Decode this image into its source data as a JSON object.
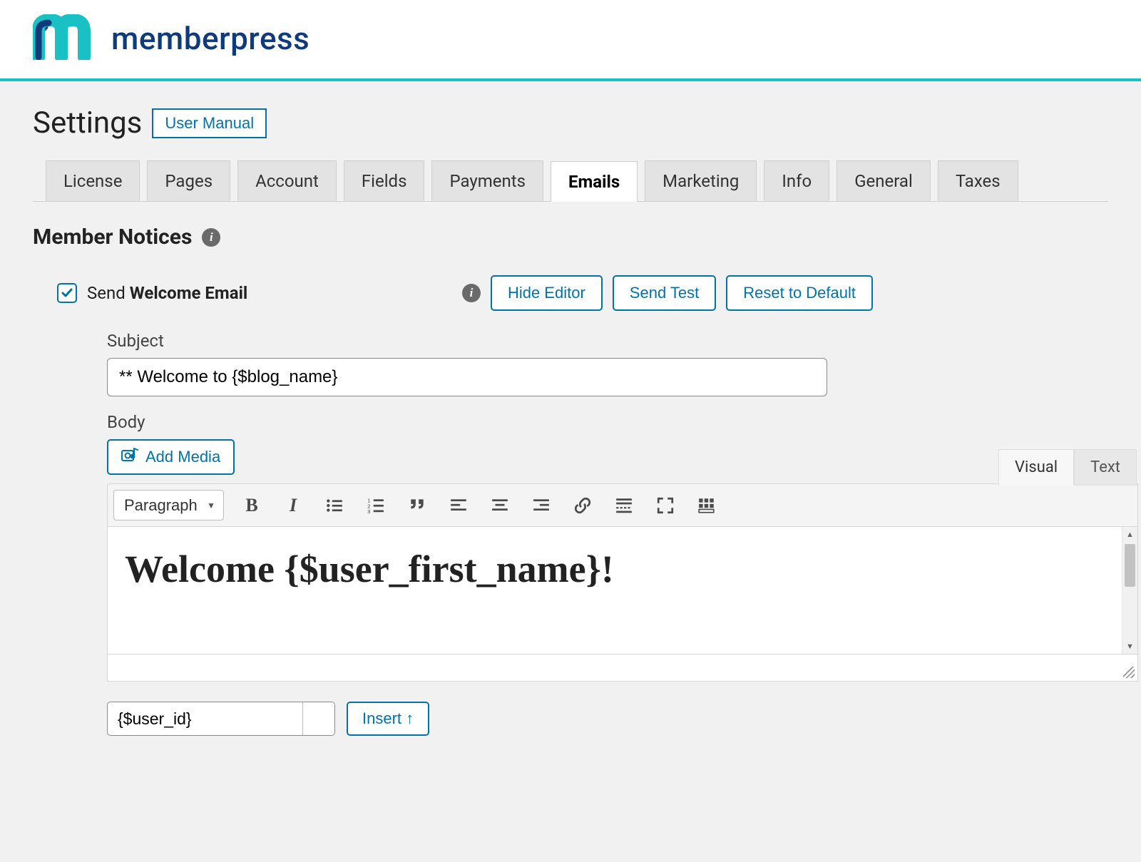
{
  "brand": {
    "name": "memberpress"
  },
  "header": {
    "title": "Settings",
    "manual_button": "User Manual"
  },
  "tabs": [
    {
      "label": "License",
      "active": false
    },
    {
      "label": "Pages",
      "active": false
    },
    {
      "label": "Account",
      "active": false
    },
    {
      "label": "Fields",
      "active": false
    },
    {
      "label": "Payments",
      "active": false
    },
    {
      "label": "Emails",
      "active": true
    },
    {
      "label": "Marketing",
      "active": false
    },
    {
      "label": "Info",
      "active": false
    },
    {
      "label": "General",
      "active": false
    },
    {
      "label": "Taxes",
      "active": false
    }
  ],
  "section": {
    "title": "Member Notices"
  },
  "notice": {
    "send_prefix": "Send ",
    "send_name": "Welcome Email",
    "checked": true,
    "actions": {
      "hide": "Hide Editor",
      "test": "Send Test",
      "reset": "Reset to Default"
    }
  },
  "subject": {
    "label": "Subject",
    "value": "** Welcome to {$blog_name}"
  },
  "body": {
    "label": "Body",
    "add_media": "Add Media",
    "editor_tabs": {
      "visual": "Visual",
      "text": "Text"
    },
    "format": "Paragraph",
    "content": "Welcome {$user_first_name}!"
  },
  "variable": {
    "selected": "{$user_id}",
    "insert": "Insert ↑"
  }
}
